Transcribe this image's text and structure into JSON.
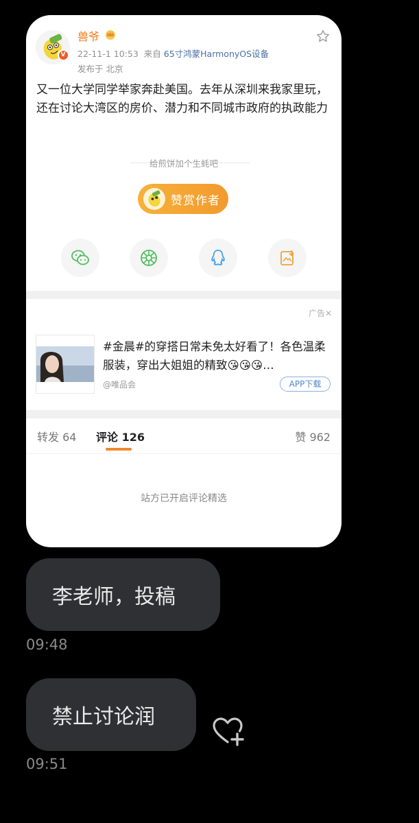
{
  "post": {
    "username": "兽爷",
    "vip_badge": "V",
    "date": "22-11-1 10:53",
    "from_label": "来自",
    "source": "65寸鸿蒙HarmonyOS设备",
    "location": "发布于 北京",
    "text": "又一位大学同学举家奔赴美国。去年从深圳来我家里玩，还在讨论大湾区的房价、潜力和不同城市政府的执政能力",
    "tip_text": "给煎饼加个生蚝吧",
    "reward_label": "赞赏作者",
    "share_icons": [
      "wechat-icon",
      "moments-icon",
      "qq-icon",
      "save-image-icon"
    ]
  },
  "ad": {
    "label": "广告✕",
    "title": "#金晨#的穿搭日常未免太好看了！各色温柔服装，穿出大姐姐的精致😘😘😘…",
    "brand": "@唯品会",
    "button": "APP下载"
  },
  "tabs": {
    "repost": "转发 64",
    "comment": "评论 126",
    "like": "赞 962"
  },
  "curated_notice": "站方已开启评论精选",
  "messages": [
    {
      "text": "李老师，投稿",
      "time": "09:48"
    },
    {
      "text": "禁止讨论润",
      "time": "09:51"
    }
  ],
  "colors": {
    "accent": "#f0882c",
    "username": "#f07c1a",
    "link": "#4a6fa5",
    "bubble": "#2f3033",
    "background": "#000000"
  }
}
